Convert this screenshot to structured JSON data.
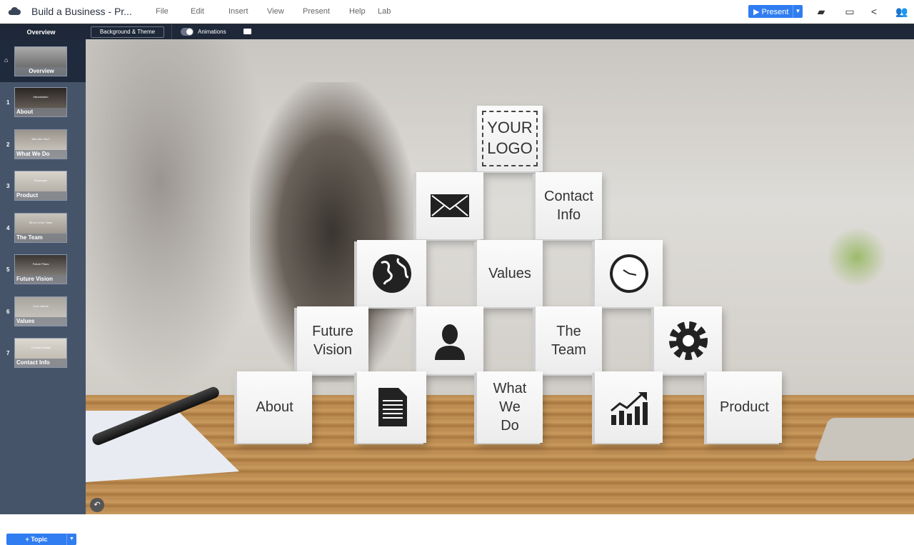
{
  "app": {
    "title": "Build a Business - Pr...",
    "menu": [
      "File",
      "Edit",
      "Insert",
      "View",
      "Present",
      "Help",
      "Lab"
    ],
    "present_label": "Present",
    "accent": "#2f7df0"
  },
  "subbar": {
    "overview": "Overview",
    "background_theme": "Background & Theme",
    "animations": "Animations",
    "animations_on": true
  },
  "sidebar": {
    "overview_label": "Overview",
    "topics": [
      {
        "num": "1",
        "label": "About",
        "thumb_title": "Introduction"
      },
      {
        "num": "2",
        "label": "What We Do",
        "thumb_title": "Who Are You?"
      },
      {
        "num": "3",
        "label": "Product",
        "thumb_title": "Showcase"
      },
      {
        "num": "4",
        "label": "The Team",
        "thumb_title": "Who's in the Team"
      },
      {
        "num": "5",
        "label": "Future Vision",
        "thumb_title": "Future Plans"
      },
      {
        "num": "6",
        "label": "Values",
        "thumb_title": "Core Values"
      },
      {
        "num": "7",
        "label": "Contact Info",
        "thumb_title": "Contact Details"
      }
    ],
    "add_topic": "+ Topic"
  },
  "slide": {
    "logo": "YOUR LOGO",
    "contact": "Contact Info",
    "values": "Values",
    "future": "Future Vision",
    "team": "The Team",
    "about": "About",
    "whatwedo": "What We Do",
    "product": "Product",
    "icons": [
      "envelope-icon",
      "globe-icon",
      "clock-icon",
      "person-icon",
      "gear-icon",
      "document-icon",
      "growth-chart-icon"
    ]
  }
}
